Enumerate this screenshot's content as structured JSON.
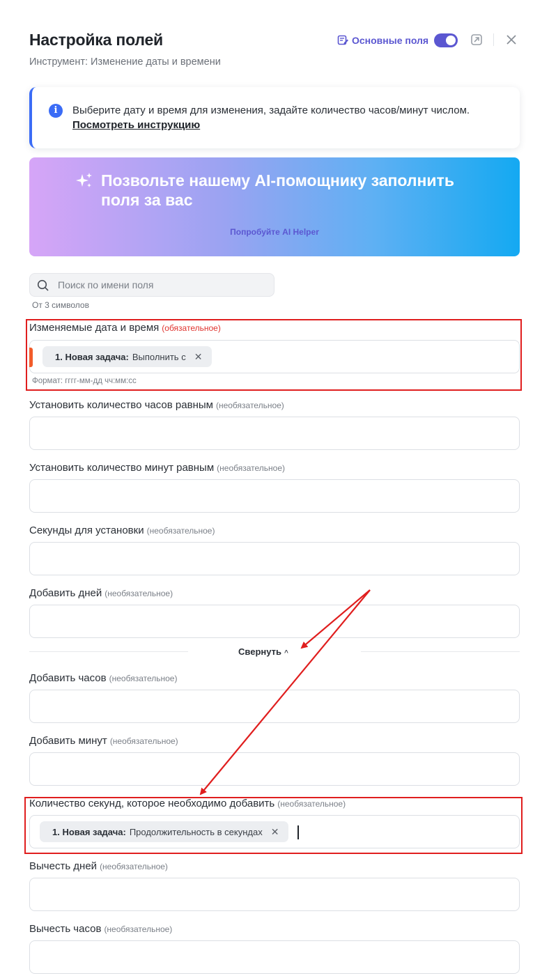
{
  "header": {
    "title": "Настройка полей",
    "subtitle": "Инструмент: Изменение даты и времени",
    "main_fields_label": "Основные поля",
    "main_fields_enabled": true
  },
  "info": {
    "text": "Выберите дату и время для изменения, задайте количество часов/минут числом.",
    "link": "Посмотреть инструкцию"
  },
  "ai_banner": {
    "title": "Позвольте нашему AI-помощнику заполнить поля за вас",
    "link": "Попробуйте AI Helper"
  },
  "search": {
    "placeholder": "Поиск по имени поля",
    "hint": "От 3 символов"
  },
  "fields": [
    {
      "label": "Изменяемые дата и время",
      "tag": "(обязательное)",
      "required": true,
      "chip": {
        "strong": "1. Новая задача:",
        "value": "Выполнить с"
      },
      "hint": "Формат: гггг-мм-дд чч:мм:сс"
    },
    {
      "label": "Установить количество часов равным",
      "tag": "(необязательное)"
    },
    {
      "label": "Установить количество минут равным",
      "tag": "(необязательное)"
    },
    {
      "label": "Секунды для установки",
      "tag": "(необязательное)"
    },
    {
      "label": "Добавить дней",
      "tag": "(необязательное)"
    },
    {
      "label": "Добавить часов",
      "tag": "(необязательное)"
    },
    {
      "label": "Добавить минут",
      "tag": "(необязательное)"
    },
    {
      "label": "Количество секунд, которое необходимо добавить",
      "tag": "(необязательное)",
      "chip": {
        "strong": "1. Новая задача:",
        "value": "Продолжительность в секундах"
      }
    },
    {
      "label": "Вычесть дней",
      "tag": "(необязательное)"
    },
    {
      "label": "Вычесть часов",
      "tag": "(необязательное)"
    }
  ],
  "collapse_label": "Свернуть",
  "icons": {
    "main_fields": "form-edit-icon",
    "pin": "pin-icon",
    "close": "close-icon",
    "info": "info-icon",
    "sparkle": "sparkle-icon",
    "search": "search-icon",
    "chip_remove": "close-icon",
    "collapse": "chevron-up-icon"
  },
  "colors": {
    "accent": "#5b57d1",
    "info": "#3b6cf6",
    "required": "#e0342f",
    "annotation": "#e01e1e",
    "var_accent": "#f25c2a"
  }
}
